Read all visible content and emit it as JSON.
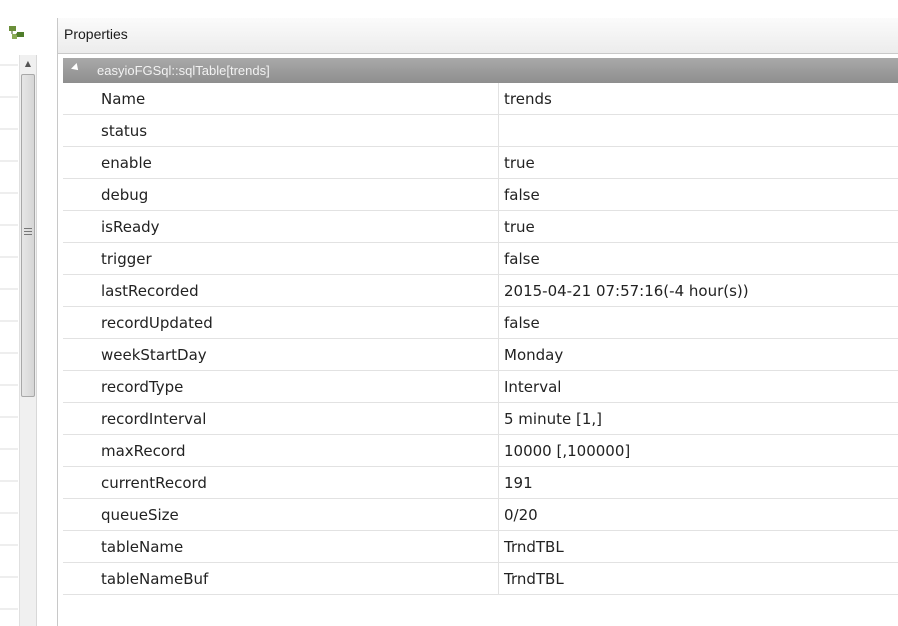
{
  "panel": {
    "title": "Properties"
  },
  "group": {
    "label": "easyioFGSql::sqlTable[trends]"
  },
  "properties": [
    {
      "name": "Name",
      "value": "trends"
    },
    {
      "name": "status",
      "value": ""
    },
    {
      "name": "enable",
      "value": "true"
    },
    {
      "name": "debug",
      "value": "false"
    },
    {
      "name": "isReady",
      "value": "true"
    },
    {
      "name": "trigger",
      "value": "false"
    },
    {
      "name": "lastRecorded",
      "value": "2015-04-21 07:57:16(-4 hour(s))"
    },
    {
      "name": "recordUpdated",
      "value": "false"
    },
    {
      "name": "weekStartDay",
      "value": "Monday"
    },
    {
      "name": "recordType",
      "value": "Interval"
    },
    {
      "name": "recordInterval",
      "value": "5 minute [1,]"
    },
    {
      "name": "maxRecord",
      "value": "10000 [,100000]"
    },
    {
      "name": "currentRecord",
      "value": "191"
    },
    {
      "name": "queueSize",
      "value": "0/20"
    },
    {
      "name": "tableName",
      "value": "TrndTBL"
    },
    {
      "name": "tableNameBuf",
      "value": "TrndTBL"
    }
  ],
  "icons": {
    "gutter": "tree-nodes-icon",
    "expand": "collapse-arrow-icon",
    "scroll_up": "scroll-up-arrow-icon"
  },
  "colors": {
    "group_bg": "#9c9c9c",
    "header_bg": "#f3f3f3",
    "grid_line": "#e2e2e2"
  }
}
